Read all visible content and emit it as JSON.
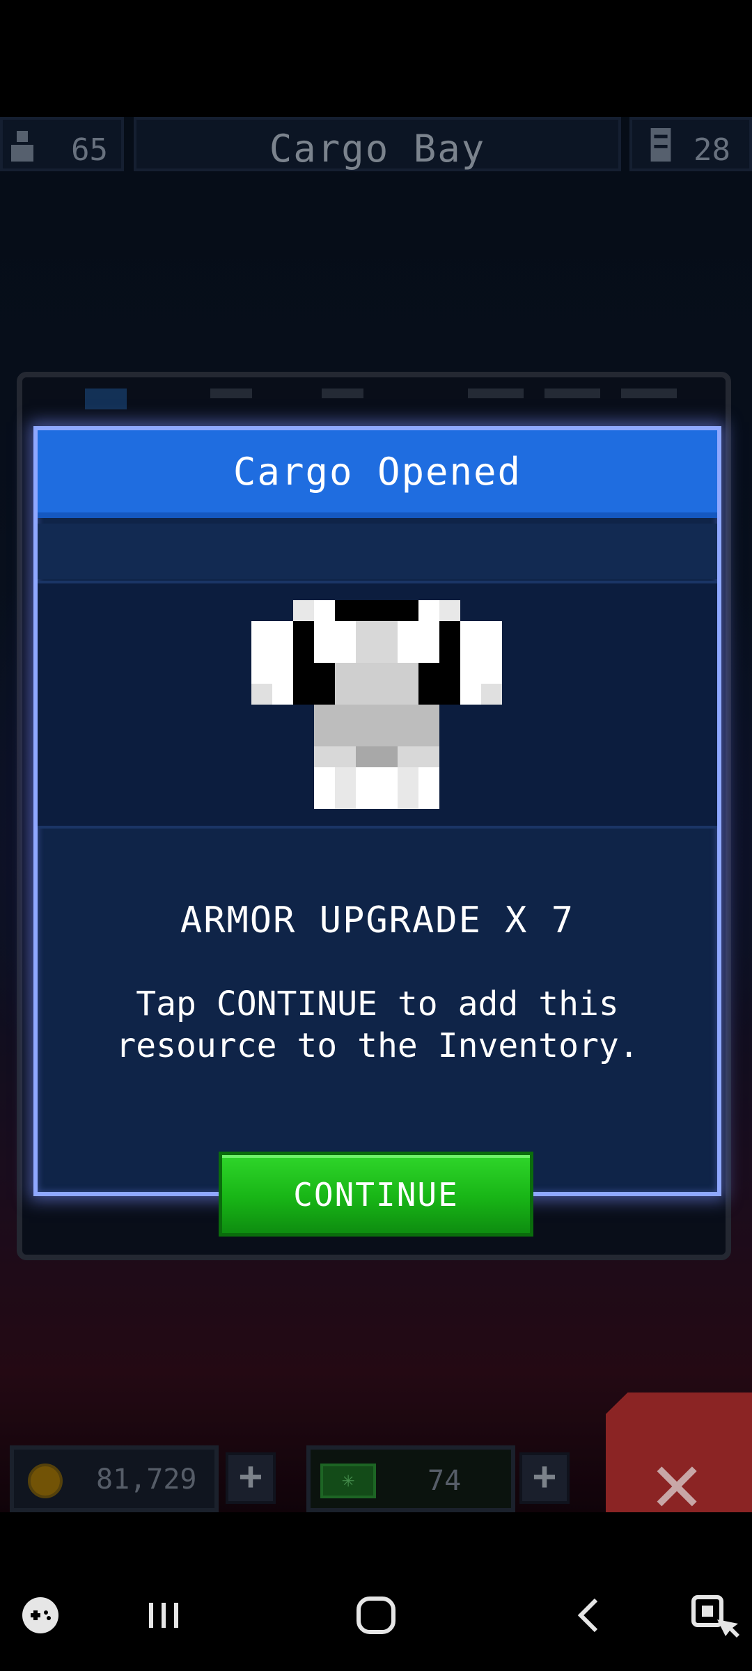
{
  "top_bar": {
    "crew_count": "65",
    "title": "Cargo Bay",
    "cargo_count": "28"
  },
  "dialog": {
    "title": "Cargo Opened",
    "item_name": "ARMOR UPGRADE X 7",
    "description": "Tap CONTINUE to add this resource to the Inventory.",
    "continue_label": "CONTINUE",
    "item_icon": "armor-upgrade-icon"
  },
  "resources": {
    "coins": "81,729",
    "gems": "74",
    "add_label": "+"
  },
  "colors": {
    "header_blue": "#1f6de0",
    "continue_green": "#18b516",
    "dialog_border": "#8fa8ff"
  }
}
